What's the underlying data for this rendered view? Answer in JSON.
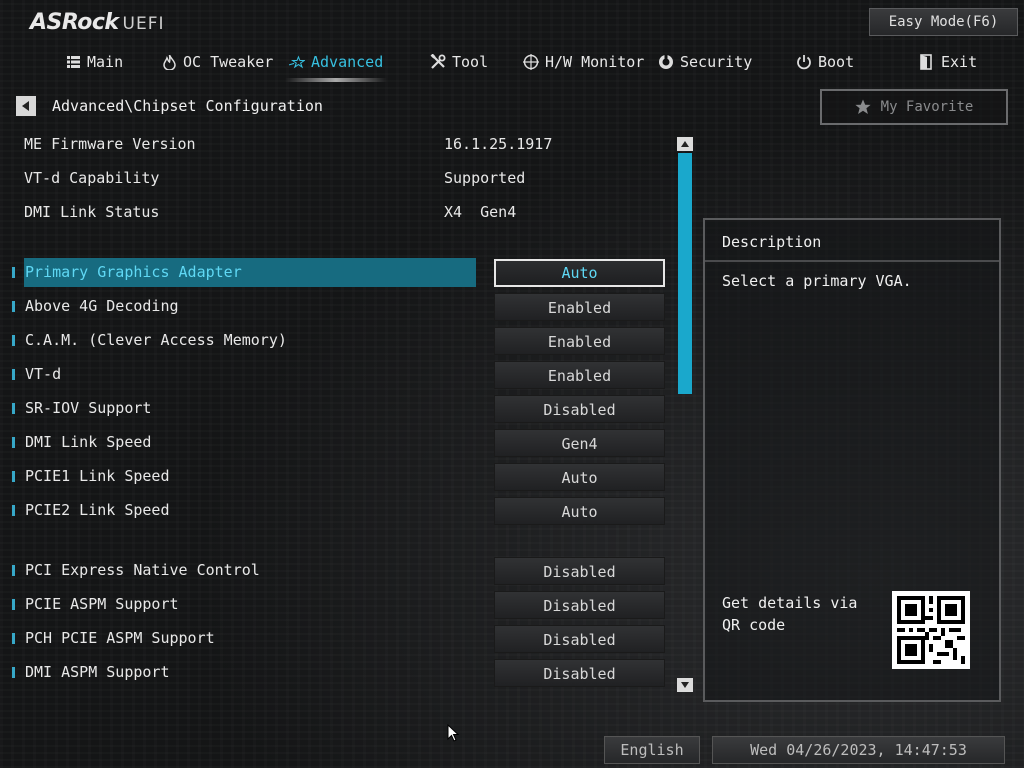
{
  "brand": {
    "logo": "ASRock",
    "suffix": "UEFI"
  },
  "header": {
    "easy_mode_label": "Easy Mode(F6)"
  },
  "nav": {
    "tabs": [
      {
        "label": "Main",
        "icon": "list-icon",
        "active": false
      },
      {
        "label": "OC Tweaker",
        "icon": "flame-icon",
        "active": false
      },
      {
        "label": "Advanced",
        "icon": "star-icon",
        "active": true
      },
      {
        "label": "Tool",
        "icon": "tools-icon",
        "active": false
      },
      {
        "label": "H/W Monitor",
        "icon": "monitor-icon",
        "active": false
      },
      {
        "label": "Security",
        "icon": "shield-icon",
        "active": false
      },
      {
        "label": "Boot",
        "icon": "power-icon",
        "active": false
      },
      {
        "label": "Exit",
        "icon": "exit-door-icon",
        "active": false
      }
    ]
  },
  "breadcrumb": "Advanced\\Chipset Configuration",
  "favorite_label": "My Favorite",
  "info": [
    {
      "label": "ME Firmware Version",
      "value": "16.1.25.1917"
    },
    {
      "label": "VT-d Capability",
      "value": "Supported"
    },
    {
      "label": "DMI Link Status",
      "value": "X4  Gen4"
    }
  ],
  "options": [
    {
      "label": "Primary Graphics Adapter",
      "value": "Auto",
      "selected": true
    },
    {
      "label": "Above 4G Decoding",
      "value": "Enabled"
    },
    {
      "label": "C.A.M. (Clever Access Memory)",
      "value": "Enabled"
    },
    {
      "label": "VT-d",
      "value": "Enabled"
    },
    {
      "label": "SR-IOV Support",
      "value": "Disabled"
    },
    {
      "label": "DMI Link Speed",
      "value": "Gen4"
    },
    {
      "label": "PCIE1 Link Speed",
      "value": "Auto"
    },
    {
      "label": "PCIE2 Link Speed",
      "value": "Auto"
    },
    {
      "label": "PCI Express Native Control",
      "value": "Disabled"
    },
    {
      "label": "PCIE ASPM Support",
      "value": "Disabled"
    },
    {
      "label": "PCH PCIE ASPM Support",
      "value": "Disabled"
    },
    {
      "label": "DMI ASPM Support",
      "value": "Disabled"
    }
  ],
  "description": {
    "title": "Description",
    "text": "Select a primary VGA.",
    "qr_text": "Get details via QR code"
  },
  "footer": {
    "language": "English",
    "datetime": "Wed 04/26/2023, 14:47:53"
  },
  "colors": {
    "accent": "#37c0e0",
    "selected_row": "#176b80",
    "scroll_thumb": "#1aa8cc"
  }
}
